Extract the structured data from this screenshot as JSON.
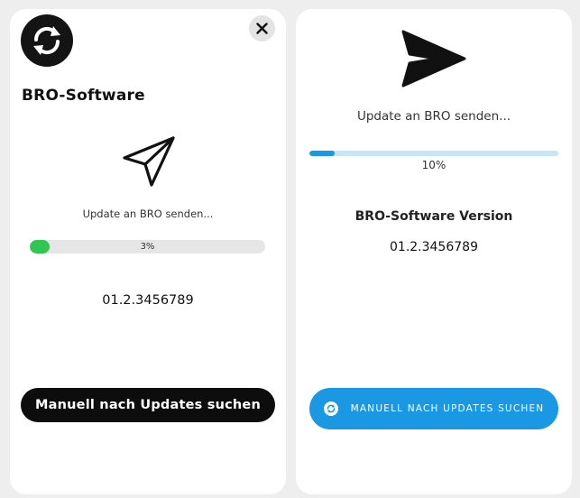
{
  "colors": {
    "background": "#eeeeee",
    "card": "#ffffff",
    "left_progress_fill": "#2fc653",
    "left_progress_track": "#e6e6e6",
    "right_progress_fill": "#1a98e4",
    "right_progress_track": "#c6e6f8",
    "primary_dark": "#0d0d0d",
    "primary_blue": "#1a98e4"
  },
  "left_card": {
    "logo_icon": "sync-icon",
    "close_icon": "close-icon",
    "title": "BRO-Software",
    "send_icon": "paper-plane-outline-icon",
    "status_text": "Update an BRO senden...",
    "progress": {
      "value": 0.03,
      "label": "3%"
    },
    "version": "01.2.3456789",
    "button_label": "Manuell nach Updates suchen"
  },
  "right_card": {
    "send_icon": "paper-plane-solid-icon",
    "status_text": "Update an BRO senden...",
    "progress": {
      "value": 0.1,
      "label": "10%"
    },
    "version_label": "BRO-Software Version",
    "version": "01.2.3456789",
    "button_icon": "refresh-icon",
    "button_label": "MANUELL NACH UPDATES SUCHEN"
  }
}
